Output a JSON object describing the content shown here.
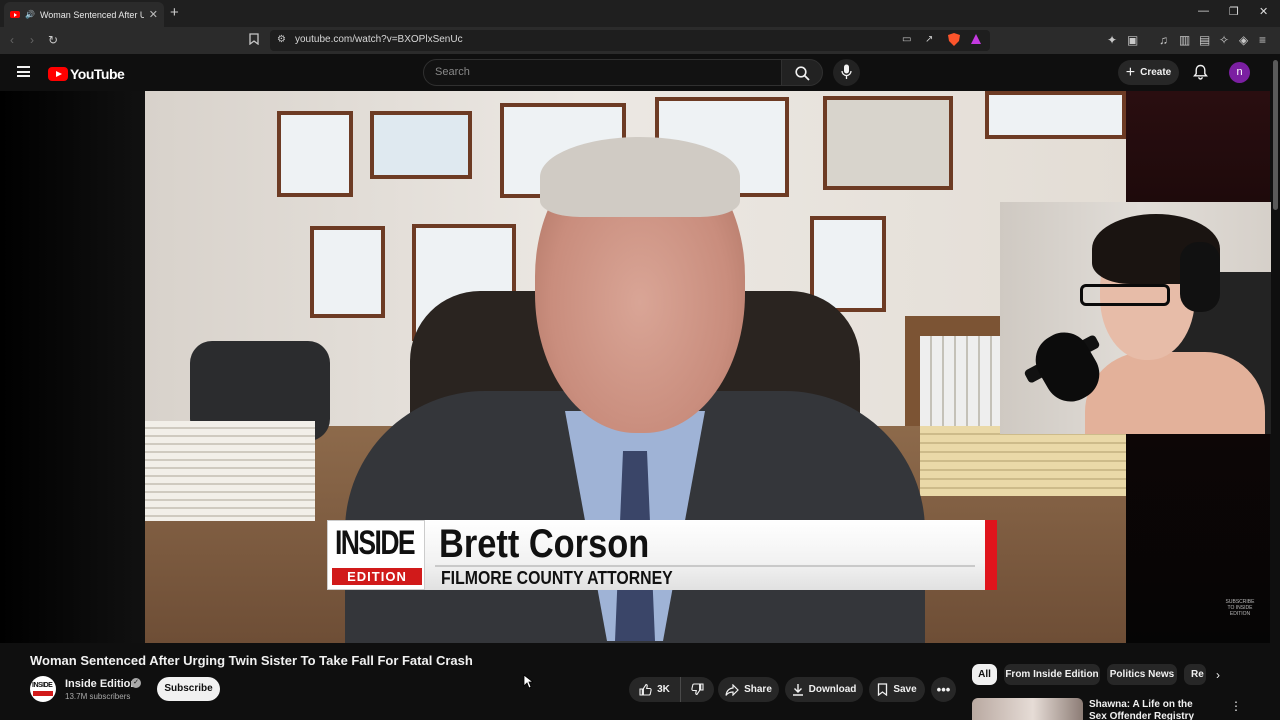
{
  "browser": {
    "tab_title": "Woman Sentenced After Urging Twin Sister To Take Fall For Fatal Crash",
    "url": "youtube.com/watch?v=BXOPlxSenUc"
  },
  "youtube": {
    "logo_text": "YouTube",
    "search_placeholder": "Search",
    "create_label": "Create",
    "avatar_letter": "n"
  },
  "player": {
    "lower_third": {
      "logo_top": "INSIDE",
      "logo_bottom": "EDITION",
      "name": "Brett Corson",
      "role": "FILMORE COUNTY ATTORNEY"
    },
    "watermark": "SUBSCRIBE TO INSIDE EDITION"
  },
  "video": {
    "title": "Woman Sentenced After Urging Twin Sister To Take Fall For Fatal Crash",
    "channel": "Inside Edition",
    "subscribers": "13.7M subscribers",
    "subscribe_label": "Subscribe",
    "likes": "3K",
    "share_label": "Share",
    "download_label": "Download",
    "save_label": "Save"
  },
  "chips": [
    {
      "label": "All"
    },
    {
      "label": "From Inside Edition"
    },
    {
      "label": "Politics News"
    },
    {
      "label": "Re"
    }
  ],
  "recommendation": {
    "title": "Shawna: A Life on the Sex Offender Registry"
  },
  "colors": {
    "brand_red": "#ff0000",
    "background": "#0f0f0f",
    "avatar_purple": "#7b1fa2"
  }
}
